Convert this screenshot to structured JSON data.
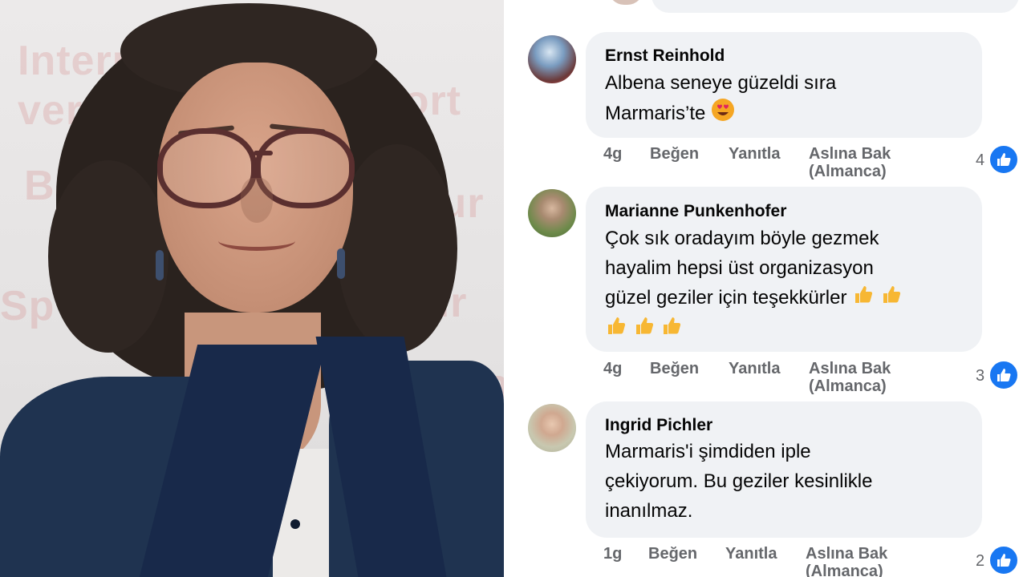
{
  "photo": {
    "wall_text": [
      "Intern",
      "vert",
      "Bil",
      "Sp",
      "port",
      "ratur",
      "tur",
      "Bera"
    ]
  },
  "comments": [
    {
      "name": "Ernst Reinhold",
      "text": "Albena seneye güzeldi sıra\nMarmaris’te",
      "emoji": "heart-eyes-emoji",
      "time": "4g",
      "like": "Beğen",
      "reply": "Yanıtla",
      "see_original": "Aslına Bak",
      "see_original_lang": "(Almanca)",
      "reactions": "4",
      "reaction_icon": "like-icon"
    },
    {
      "name": "Marianne Punkenhofer",
      "text": "Çok sık oradayım böyle gezmek\nhayalim hepsi üst organizasyon\ngüzel geziler için teşekkürler",
      "emoji": "thumbs-up-emoji",
      "emoji_count": 5,
      "time": "4g",
      "like": "Beğen",
      "reply": "Yanıtla",
      "see_original": "Aslına Bak",
      "see_original_lang": "(Almanca)",
      "reactions": "3",
      "reaction_icon": "like-icon"
    },
    {
      "name": "Ingrid Pichler",
      "text": "Marmaris'i şimdiden iple\nçekiyorum. Bu geziler kesinlikle\ninanılmaz.",
      "time": "1g",
      "like": "Beğen",
      "reply": "Yanıtla",
      "see_original": "Aslına Bak",
      "see_original_lang": "(Almanca)",
      "reactions": "2",
      "reaction_icon": "like-icon"
    }
  ],
  "colors": {
    "bubble": "#f0f2f5",
    "meta": "#65676b",
    "like_blue": "#1877f2",
    "text": "#050505"
  }
}
